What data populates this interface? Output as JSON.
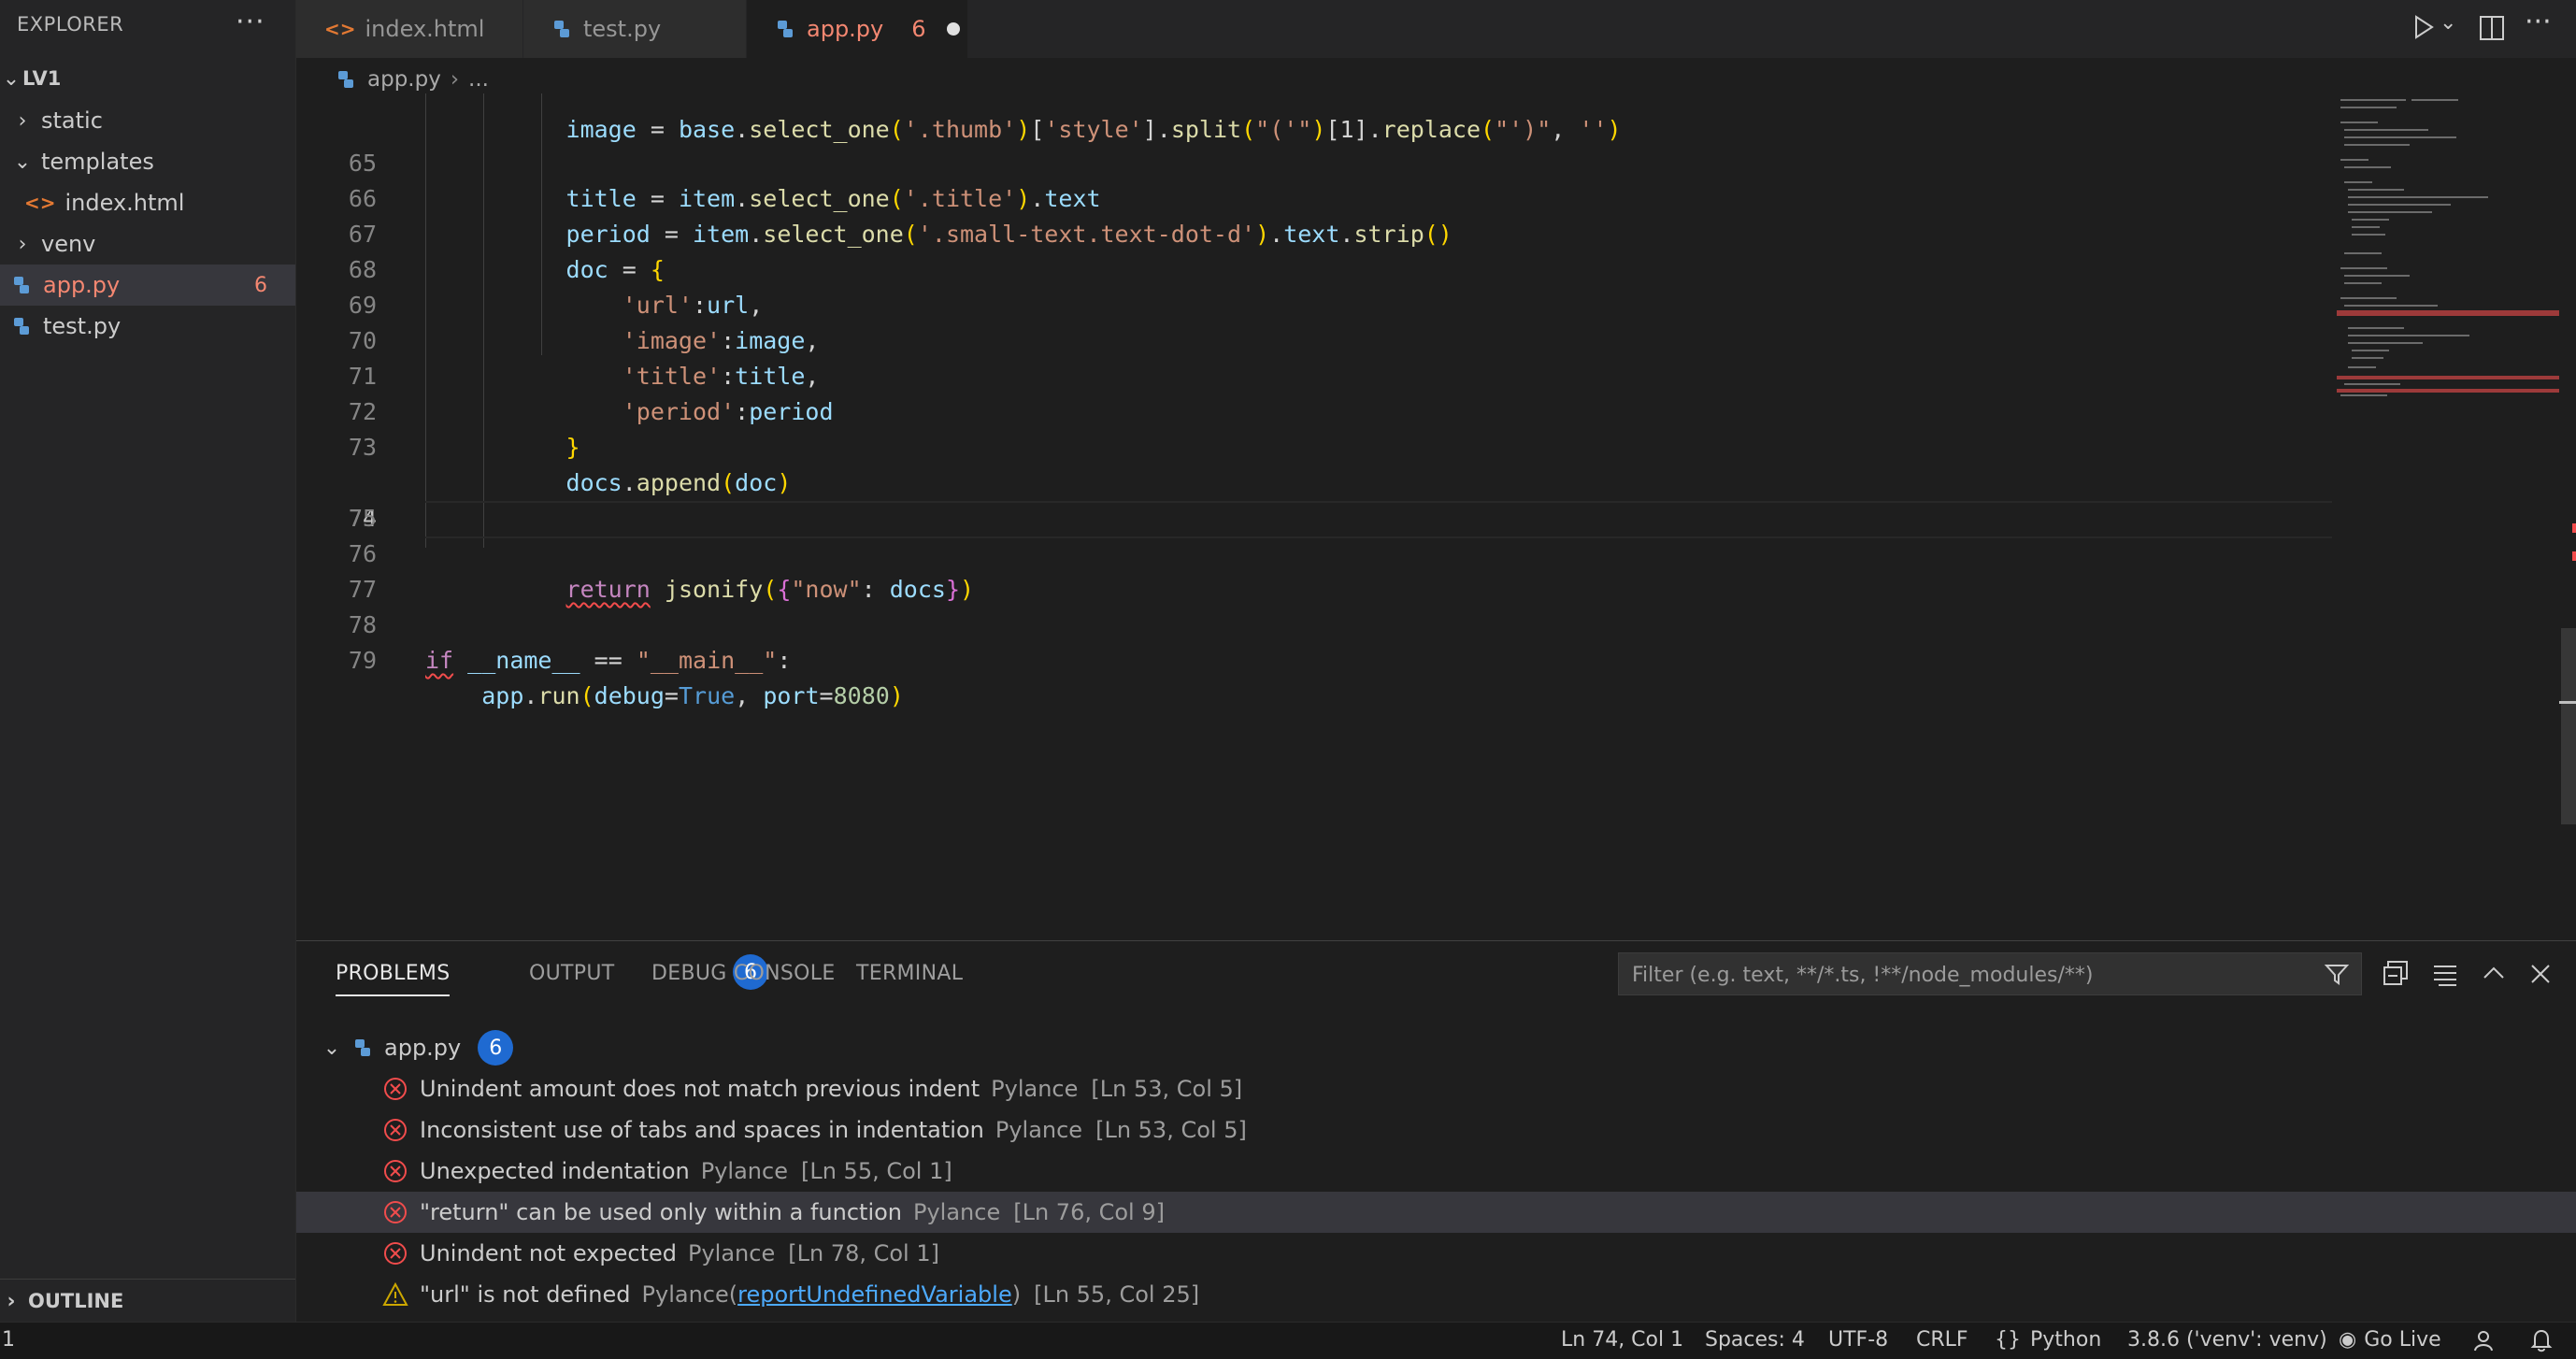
{
  "sidebar": {
    "header": "EXPLORER",
    "more_icon": "ellipsis-icon",
    "folder": "LV1",
    "items": [
      {
        "label": "static"
      },
      {
        "label": "templates"
      },
      {
        "label": "index.html"
      },
      {
        "label": "venv"
      },
      {
        "label": "app.py",
        "badge": "6"
      },
      {
        "label": "test.py"
      }
    ],
    "outline": "OUTLINE"
  },
  "tabs": [
    {
      "label": "index.html"
    },
    {
      "label": "test.py"
    },
    {
      "label": "app.py",
      "badge": "6",
      "modified": true
    }
  ],
  "breadcrumb": {
    "file": "app.py",
    "rest": "..."
  },
  "editor": {
    "lines": [
      {
        "n": "65"
      },
      {
        "n": "66"
      },
      {
        "n": "67"
      },
      {
        "n": "68"
      },
      {
        "n": "69"
      },
      {
        "n": "70"
      },
      {
        "n": "71"
      },
      {
        "n": "72"
      },
      {
        "n": "73"
      },
      {
        "n": "74"
      },
      {
        "n": "75"
      },
      {
        "n": "76"
      },
      {
        "n": "77"
      },
      {
        "n": "78"
      },
      {
        "n": "79"
      }
    ],
    "current_line": "74"
  },
  "panel": {
    "tabs": {
      "problems": "PROBLEMS",
      "problems_count": "6",
      "output": "OUTPUT",
      "debug": "DEBUG CONSOLE",
      "terminal": "TERMINAL"
    },
    "filter_placeholder": "Filter (e.g. text, **/*.ts, !**/node_modules/**)",
    "group": {
      "file": "app.py",
      "count": "6"
    },
    "problems": [
      {
        "severity": "error",
        "message": "Unindent amount does not match previous indent",
        "source": "Pylance",
        "position": "[Ln 53, Col 5]"
      },
      {
        "severity": "error",
        "message": "Inconsistent use of tabs and spaces in indentation",
        "source": "Pylance",
        "position": "[Ln 53, Col 5]"
      },
      {
        "severity": "error",
        "message": "Unexpected indentation",
        "source": "Pylance",
        "position": "[Ln 55, Col 1]"
      },
      {
        "severity": "error",
        "message": "\"return\" can be used only within a function",
        "source": "Pylance",
        "position": "[Ln 76, Col 9]"
      },
      {
        "severity": "error",
        "message": "Unindent not expected",
        "source": "Pylance",
        "position": "[Ln 78, Col 1]"
      },
      {
        "severity": "warning",
        "message": "\"url\" is not defined",
        "source": "Pylance",
        "rule": "reportUndefinedVariable",
        "position": "[Ln 55, Col 25]"
      }
    ]
  },
  "statusbar": {
    "left": "1",
    "position": "Ln 74, Col 1",
    "spaces": "Spaces: 4",
    "encoding": "UTF-8",
    "eol": "CRLF",
    "language": "Python",
    "interpreter": "3.8.6 ('venv': venv)",
    "golive": "Go Live"
  },
  "colors": {
    "error": "#f14c4c",
    "warning": "#cca700",
    "accent_badge": "#1f6ad1",
    "modified_tab": "#f48771"
  }
}
